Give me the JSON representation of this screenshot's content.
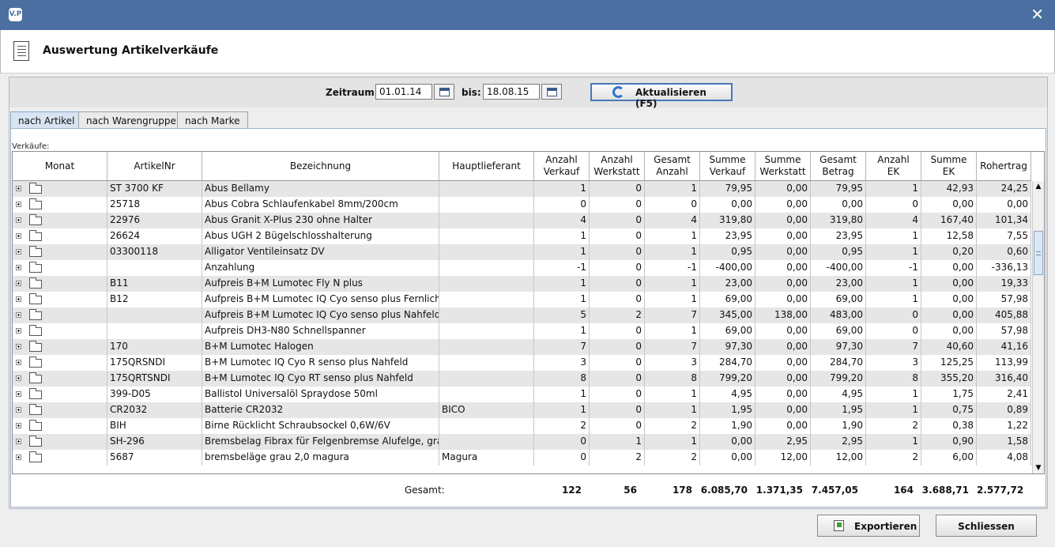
{
  "window": {
    "logo_text": "V.P",
    "close_glyph": "✕"
  },
  "header": {
    "title": "Auswertung Artikelverkäufe"
  },
  "filter": {
    "zeitraum_label": "Zeitraum:",
    "von": "01.01.14",
    "bis_label": "bis:",
    "bis": "18.08.15",
    "refresh_label": "Aktualisieren (F5)"
  },
  "tabs": [
    "nach Artikel",
    "nach Warengruppe",
    "nach Marke"
  ],
  "section_label": "Verkäufe:",
  "columns": [
    [
      "Monat"
    ],
    [
      "ArtikelNr"
    ],
    [
      "Bezeichnung"
    ],
    [
      "Hauptlieferant"
    ],
    [
      "Anzahl",
      "Verkauf"
    ],
    [
      "Anzahl",
      "Werkstatt"
    ],
    [
      "Gesamt",
      "Anzahl"
    ],
    [
      "Summe",
      "Verkauf"
    ],
    [
      "Summe",
      "Werkstatt"
    ],
    [
      "Gesamt",
      "Betrag"
    ],
    [
      "Anzahl",
      "EK"
    ],
    [
      "Summe",
      "EK"
    ],
    [
      "Rohertrag"
    ]
  ],
  "rows": [
    [
      "ST 3700 KF",
      "Abus Bellamy",
      "",
      "1",
      "0",
      "1",
      "79,95",
      "0,00",
      "79,95",
      "1",
      "42,93",
      "24,25"
    ],
    [
      "25718",
      "Abus Cobra Schlaufenkabel 8mm/200cm",
      "",
      "0",
      "0",
      "0",
      "0,00",
      "0,00",
      "0,00",
      "0",
      "0,00",
      "0,00"
    ],
    [
      "22976",
      "Abus Granit X-Plus 230 ohne Halter",
      "",
      "4",
      "0",
      "4",
      "319,80",
      "0,00",
      "319,80",
      "4",
      "167,40",
      "101,34"
    ],
    [
      "26624",
      "Abus UGH 2 Bügelschlosshalterung",
      "",
      "1",
      "0",
      "1",
      "23,95",
      "0,00",
      "23,95",
      "1",
      "12,58",
      "7,55"
    ],
    [
      "03300118",
      "Alligator Ventileinsatz DV",
      "",
      "1",
      "0",
      "1",
      "0,95",
      "0,00",
      "0,95",
      "1",
      "0,20",
      "0,60"
    ],
    [
      "",
      "Anzahlung",
      "",
      "-1",
      "0",
      "-1",
      "-400,00",
      "0,00",
      "-400,00",
      "-1",
      "0,00",
      "-336,13"
    ],
    [
      "B11",
      "Aufpreis B+M Lumotec Fly N plus",
      "",
      "1",
      "0",
      "1",
      "23,00",
      "0,00",
      "23,00",
      "1",
      "0,00",
      "19,33"
    ],
    [
      "B12",
      "Aufpreis B+M Lumotec IQ Cyo senso plus Fernlicht",
      "",
      "1",
      "0",
      "1",
      "69,00",
      "0,00",
      "69,00",
      "1",
      "0,00",
      "57,98"
    ],
    [
      "",
      "Aufpreis B+M Lumotec IQ Cyo senso plus Nahfeld",
      "",
      "5",
      "2",
      "7",
      "345,00",
      "138,00",
      "483,00",
      "0",
      "0,00",
      "405,88"
    ],
    [
      "",
      "Aufpreis DH3-N80 Schnellspanner",
      "",
      "1",
      "0",
      "1",
      "69,00",
      "0,00",
      "69,00",
      "0",
      "0,00",
      "57,98"
    ],
    [
      "170",
      "B+M Lumotec Halogen",
      "",
      "7",
      "0",
      "7",
      "97,30",
      "0,00",
      "97,30",
      "7",
      "40,60",
      "41,16"
    ],
    [
      "175QRSNDI",
      "B+M Lumotec IQ Cyo R senso plus Nahfeld",
      "",
      "3",
      "0",
      "3",
      "284,70",
      "0,00",
      "284,70",
      "3",
      "125,25",
      "113,99"
    ],
    [
      "175QRTSNDI",
      "B+M Lumotec IQ Cyo RT senso plus Nahfeld",
      "",
      "8",
      "0",
      "8",
      "799,20",
      "0,00",
      "799,20",
      "8",
      "355,20",
      "316,40"
    ],
    [
      "399-D05",
      "Ballistol Universalöl Spraydose 50ml",
      "",
      "1",
      "0",
      "1",
      "4,95",
      "0,00",
      "4,95",
      "1",
      "1,75",
      "2,41"
    ],
    [
      "CR2032",
      "Batterie CR2032",
      "BICO",
      "1",
      "0",
      "1",
      "1,95",
      "0,00",
      "1,95",
      "1",
      "0,75",
      "0,89"
    ],
    [
      "BIH",
      "Birne Rücklicht Schraubsockel 0,6W/6V",
      "",
      "2",
      "0",
      "2",
      "1,90",
      "0,00",
      "1,90",
      "2",
      "0,38",
      "1,22"
    ],
    [
      "SH-296",
      "Bremsbelag Fibrax für Felgenbremse Alufelge, grau",
      "",
      "0",
      "1",
      "1",
      "0,00",
      "2,95",
      "2,95",
      "1",
      "0,90",
      "1,58"
    ],
    [
      "5687",
      "bremsbeläge grau 2,0 magura",
      "Magura",
      "0",
      "2",
      "2",
      "0,00",
      "12,00",
      "12,00",
      "2",
      "6,00",
      "4,08"
    ]
  ],
  "totals": {
    "label": "Gesamt:",
    "values": [
      "122",
      "56",
      "178",
      "6.085,70",
      "1.371,35",
      "7.457,05",
      "164",
      "3.688,71",
      "2.577,72"
    ]
  },
  "buttons": {
    "export": "Exportieren",
    "close": "Schliessen"
  },
  "scrollbar": {
    "up": "▲",
    "down": "▼"
  }
}
